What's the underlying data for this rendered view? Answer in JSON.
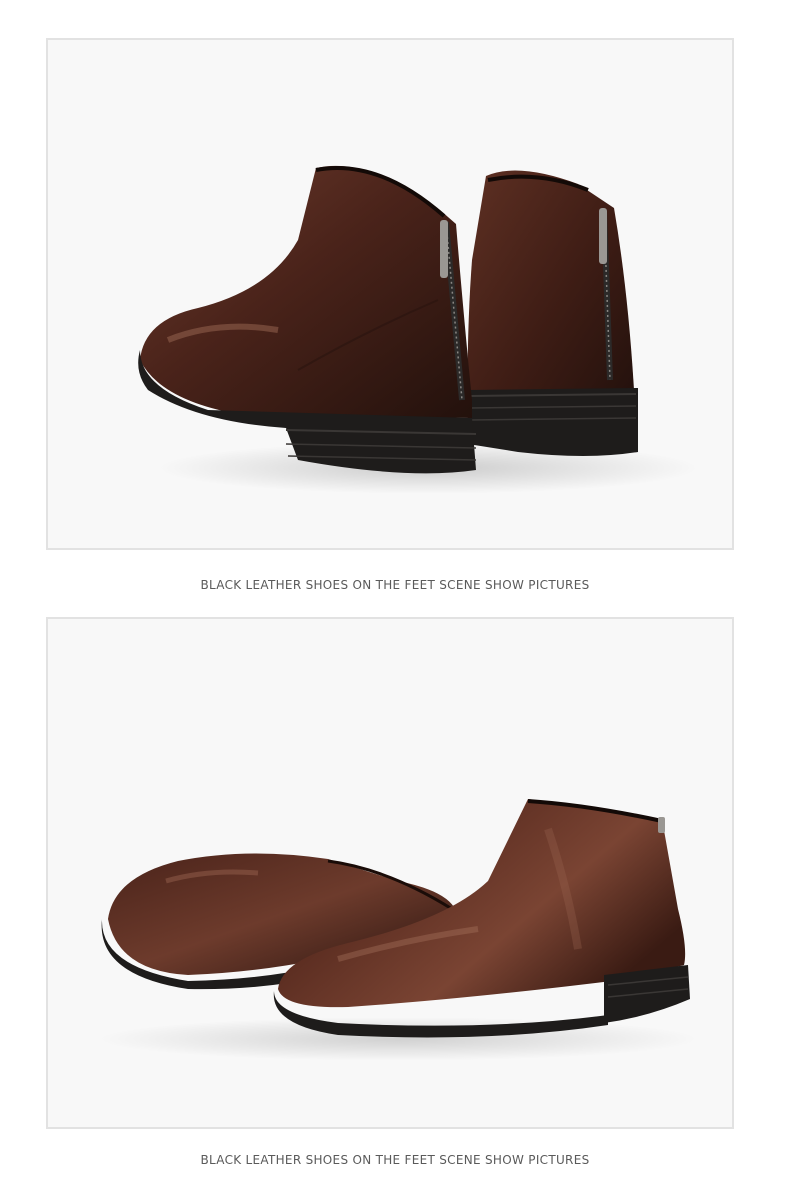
{
  "sections": [
    {
      "photo_subject": "boots-rear-view",
      "caption": "BLACK LEATHER SHOES ON THE FEET SCENE SHOW PICTURES"
    },
    {
      "photo_subject": "boots-side-view",
      "caption": "BLACK LEATHER SHOES ON THE FEET SCENE SHOW PICTURES"
    }
  ],
  "colors": {
    "leather_dark": "#2a140f",
    "leather_mid": "#4a231a",
    "leather_light": "#7a4433",
    "sole": "#1e1c1b",
    "background": "#f8f8f8",
    "frame_border": "#e2e2e2",
    "caption_text": "#5a5a5a"
  }
}
